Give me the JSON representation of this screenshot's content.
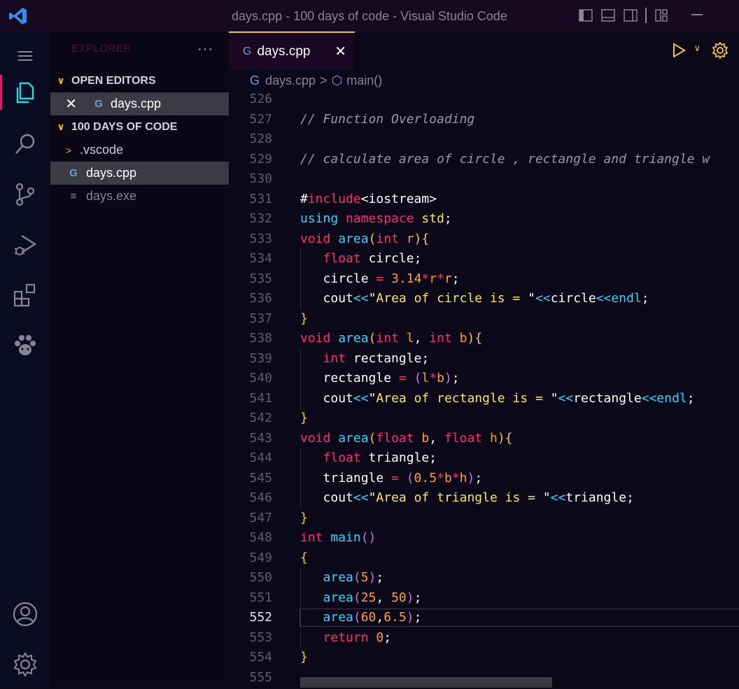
{
  "window": {
    "title": "days.cpp - 100 days of code - Visual Studio Code"
  },
  "sidebar": {
    "header": "EXPLORER",
    "open_editors": {
      "title": "OPEN EDITORS",
      "items": [
        {
          "name": "days.cpp"
        }
      ]
    },
    "folder": {
      "title": "100 DAYS OF CODE",
      "items": [
        {
          "name": ".vscode",
          "type": "folder"
        },
        {
          "name": "days.cpp",
          "type": "file-cpp"
        },
        {
          "name": "days.exe",
          "type": "file-exe"
        }
      ]
    }
  },
  "tabs": [
    {
      "label": "days.cpp",
      "active": true
    }
  ],
  "breadcrumb": {
    "file": "days.cpp",
    "symbol": "main()"
  },
  "editor": {
    "current_line": 552,
    "lines": [
      {
        "n": "526",
        "tokens": []
      },
      {
        "n": "527",
        "tokens": [
          {
            "t": "// Function Overloading",
            "c": "cm"
          }
        ]
      },
      {
        "n": "528",
        "tokens": []
      },
      {
        "n": "529",
        "tokens": [
          {
            "t": "// calculate area of circle , rectangle and triangle w",
            "c": "cm"
          }
        ]
      },
      {
        "n": "530",
        "tokens": []
      },
      {
        "n": "531",
        "tokens": [
          {
            "t": "#",
            "c": "w"
          },
          {
            "t": "include",
            "c": "kw"
          },
          {
            "t": "<iostream>",
            "c": "w"
          }
        ]
      },
      {
        "n": "532",
        "tokens": [
          {
            "t": "using ",
            "c": "fn"
          },
          {
            "t": "namespace ",
            "c": "kw"
          },
          {
            "t": "std",
            "c": "str"
          },
          {
            "t": ";",
            "c": "w"
          }
        ]
      },
      {
        "n": "533",
        "tokens": [
          {
            "t": "void ",
            "c": "ty"
          },
          {
            "t": "area",
            "c": "fn"
          },
          {
            "t": "(",
            "c": "br"
          },
          {
            "t": "int ",
            "c": "ty"
          },
          {
            "t": "r",
            "c": "par"
          },
          {
            "t": "){",
            "c": "br"
          }
        ]
      },
      {
        "n": "534",
        "tokens": [
          {
            "t": "   "
          },
          {
            "t": "float ",
            "c": "ty"
          },
          {
            "t": "circle;",
            "c": "w"
          }
        ]
      },
      {
        "n": "535",
        "tokens": [
          {
            "t": "   "
          },
          {
            "t": "circle ",
            "c": "w"
          },
          {
            "t": "= ",
            "c": "op"
          },
          {
            "t": "3.14",
            "c": "num"
          },
          {
            "t": "*",
            "c": "op"
          },
          {
            "t": "r",
            "c": "par"
          },
          {
            "t": "*",
            "c": "op"
          },
          {
            "t": "r",
            "c": "par"
          },
          {
            "t": ";",
            "c": "w"
          }
        ]
      },
      {
        "n": "536",
        "tokens": [
          {
            "t": "   "
          },
          {
            "t": "cout",
            "c": "w"
          },
          {
            "t": "<<",
            "c": "fn"
          },
          {
            "t": "\"",
            "c": "w"
          },
          {
            "t": "Area of circle is = ",
            "c": "str"
          },
          {
            "t": "\"",
            "c": "w"
          },
          {
            "t": "<<",
            "c": "fn"
          },
          {
            "t": "circle",
            "c": "w"
          },
          {
            "t": "<<",
            "c": "fn"
          },
          {
            "t": "endl",
            "c": "fn"
          },
          {
            "t": ";",
            "c": "w"
          }
        ]
      },
      {
        "n": "537",
        "tokens": [
          {
            "t": "}",
            "c": "br"
          }
        ]
      },
      {
        "n": "538",
        "tokens": [
          {
            "t": "void ",
            "c": "ty"
          },
          {
            "t": "area",
            "c": "fn"
          },
          {
            "t": "(",
            "c": "br"
          },
          {
            "t": "int ",
            "c": "ty"
          },
          {
            "t": "l",
            "c": "par"
          },
          {
            "t": ", ",
            "c": "w"
          },
          {
            "t": "int ",
            "c": "ty"
          },
          {
            "t": "b",
            "c": "par"
          },
          {
            "t": "){",
            "c": "br"
          }
        ]
      },
      {
        "n": "539",
        "tokens": [
          {
            "t": "   "
          },
          {
            "t": "int ",
            "c": "ty"
          },
          {
            "t": "rectangle;",
            "c": "w"
          }
        ]
      },
      {
        "n": "540",
        "tokens": [
          {
            "t": "   "
          },
          {
            "t": "rectangle ",
            "c": "w"
          },
          {
            "t": "= ",
            "c": "op"
          },
          {
            "t": "(",
            "c": "pr"
          },
          {
            "t": "l",
            "c": "par"
          },
          {
            "t": "*",
            "c": "op"
          },
          {
            "t": "b",
            "c": "par"
          },
          {
            "t": ")",
            "c": "pr"
          },
          {
            "t": ";",
            "c": "w"
          }
        ]
      },
      {
        "n": "541",
        "tokens": [
          {
            "t": "   "
          },
          {
            "t": "cout",
            "c": "w"
          },
          {
            "t": "<<",
            "c": "fn"
          },
          {
            "t": "\"",
            "c": "w"
          },
          {
            "t": "Area of rectangle is = ",
            "c": "str"
          },
          {
            "t": "\"",
            "c": "w"
          },
          {
            "t": "<<",
            "c": "fn"
          },
          {
            "t": "rectangle",
            "c": "w"
          },
          {
            "t": "<<",
            "c": "fn"
          },
          {
            "t": "endl",
            "c": "fn"
          },
          {
            "t": ";",
            "c": "w"
          }
        ]
      },
      {
        "n": "542",
        "tokens": [
          {
            "t": "}",
            "c": "br"
          }
        ]
      },
      {
        "n": "543",
        "tokens": [
          {
            "t": "void ",
            "c": "ty"
          },
          {
            "t": "area",
            "c": "fn"
          },
          {
            "t": "(",
            "c": "br"
          },
          {
            "t": "float ",
            "c": "ty"
          },
          {
            "t": "b",
            "c": "par"
          },
          {
            "t": ", ",
            "c": "w"
          },
          {
            "t": "float ",
            "c": "ty"
          },
          {
            "t": "h",
            "c": "par"
          },
          {
            "t": "){",
            "c": "br"
          }
        ]
      },
      {
        "n": "544",
        "tokens": [
          {
            "t": "   "
          },
          {
            "t": "float ",
            "c": "ty"
          },
          {
            "t": "triangle;",
            "c": "w"
          }
        ]
      },
      {
        "n": "545",
        "tokens": [
          {
            "t": "   "
          },
          {
            "t": "triangle ",
            "c": "w"
          },
          {
            "t": "= ",
            "c": "op"
          },
          {
            "t": "(",
            "c": "pr"
          },
          {
            "t": "0.5",
            "c": "num"
          },
          {
            "t": "*",
            "c": "op"
          },
          {
            "t": "b",
            "c": "par"
          },
          {
            "t": "*",
            "c": "op"
          },
          {
            "t": "h",
            "c": "par"
          },
          {
            "t": ")",
            "c": "pr"
          },
          {
            "t": ";",
            "c": "w"
          }
        ]
      },
      {
        "n": "546",
        "tokens": [
          {
            "t": "   "
          },
          {
            "t": "cout",
            "c": "w"
          },
          {
            "t": "<<",
            "c": "fn"
          },
          {
            "t": "\"",
            "c": "w"
          },
          {
            "t": "Area of triangle is = ",
            "c": "str"
          },
          {
            "t": "\"",
            "c": "w"
          },
          {
            "t": "<<",
            "c": "fn"
          },
          {
            "t": "triangle",
            "c": "w"
          },
          {
            "t": ";",
            "c": "w"
          }
        ]
      },
      {
        "n": "547",
        "tokens": [
          {
            "t": "}",
            "c": "br"
          }
        ]
      },
      {
        "n": "548",
        "tokens": [
          {
            "t": "int ",
            "c": "ty"
          },
          {
            "t": "main",
            "c": "fn"
          },
          {
            "t": "()",
            "c": "pr"
          }
        ]
      },
      {
        "n": "549",
        "tokens": [
          {
            "t": "{",
            "c": "br"
          }
        ]
      },
      {
        "n": "550",
        "tokens": [
          {
            "t": "   "
          },
          {
            "t": "area",
            "c": "fn"
          },
          {
            "t": "(",
            "c": "pr"
          },
          {
            "t": "5",
            "c": "num"
          },
          {
            "t": ")",
            "c": "pr"
          },
          {
            "t": ";",
            "c": "w"
          }
        ]
      },
      {
        "n": "551",
        "tokens": [
          {
            "t": "   "
          },
          {
            "t": "area",
            "c": "fn"
          },
          {
            "t": "(",
            "c": "pr"
          },
          {
            "t": "25",
            "c": "num"
          },
          {
            "t": ", ",
            "c": "w"
          },
          {
            "t": "50",
            "c": "num"
          },
          {
            "t": ")",
            "c": "pr"
          },
          {
            "t": ";",
            "c": "w"
          }
        ]
      },
      {
        "n": "552",
        "tokens": [
          {
            "t": "   "
          },
          {
            "t": "area",
            "c": "fn"
          },
          {
            "t": "(",
            "c": "pr"
          },
          {
            "t": "60",
            "c": "num"
          },
          {
            "t": ",",
            "c": "w"
          },
          {
            "t": "6.5",
            "c": "num"
          },
          {
            "t": ")",
            "c": "pr"
          },
          {
            "t": ";",
            "c": "w"
          }
        ]
      },
      {
        "n": "553",
        "tokens": [
          {
            "t": "   "
          },
          {
            "t": "return ",
            "c": "kw"
          },
          {
            "t": "0",
            "c": "num"
          },
          {
            "t": ";",
            "c": "w"
          }
        ]
      },
      {
        "n": "554",
        "tokens": [
          {
            "t": "}",
            "c": "br"
          }
        ]
      },
      {
        "n": "555",
        "tokens": []
      }
    ]
  }
}
